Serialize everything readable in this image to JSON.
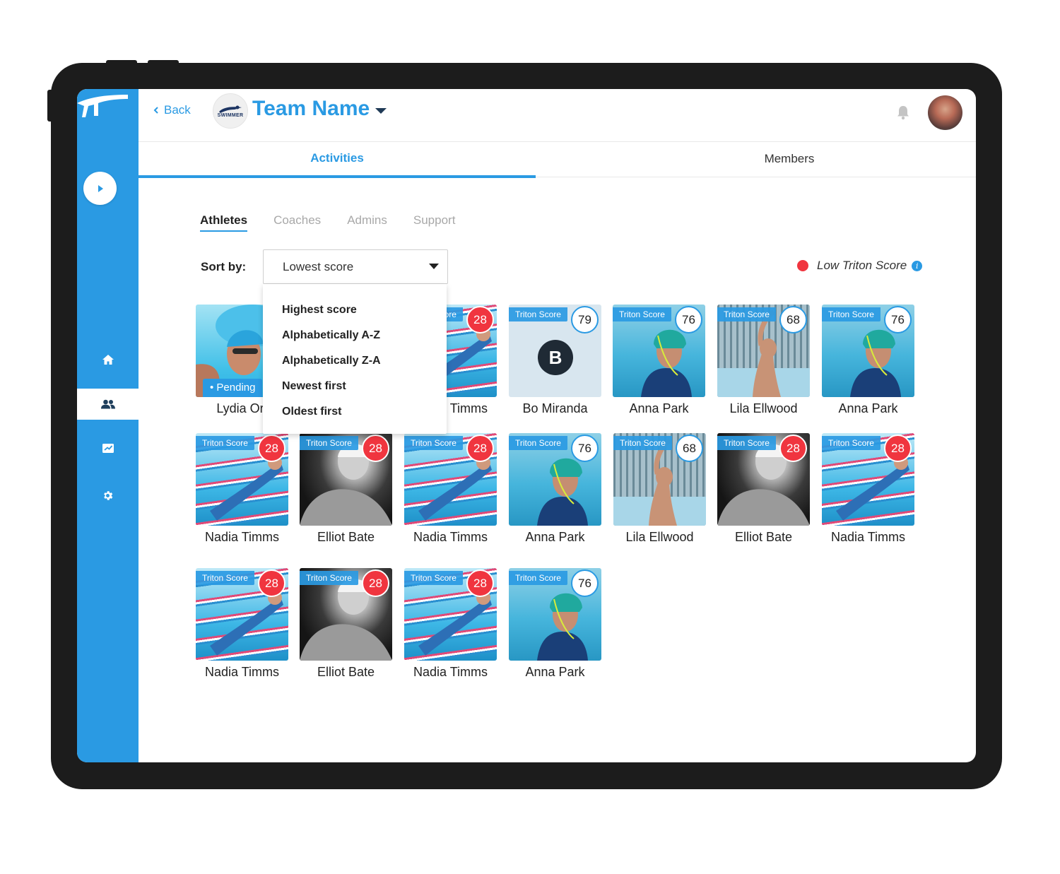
{
  "header": {
    "back_label": "Back",
    "team_logo_text": "SWIMMER",
    "team_name": "Team Name"
  },
  "tabs": [
    {
      "label": "Activities",
      "active": true
    },
    {
      "label": "Members",
      "active": false
    }
  ],
  "subtabs": [
    {
      "label": "Athletes",
      "active": true
    },
    {
      "label": "Coaches",
      "active": false
    },
    {
      "label": "Admins",
      "active": false
    },
    {
      "label": "Support",
      "active": false
    }
  ],
  "sort": {
    "label": "Sort by:",
    "value": "Lowest score",
    "options": [
      "Highest score",
      "Alphabetically A-Z",
      "Alphabetically Z-A",
      "Newest first",
      "Oldest first"
    ]
  },
  "legend": {
    "text": "Low Triton Score",
    "info_glyph": "i",
    "color": "#f0353f"
  },
  "score_label": "Triton Score",
  "pending_label": "• Pending",
  "bo_initial": "B",
  "athletes": [
    {
      "name": "Lydia Ort",
      "score": null,
      "pending": true
    },
    {
      "name": "Nadia Timms",
      "score": "28",
      "low": true
    },
    {
      "name": "Bo Miranda",
      "score": "79",
      "low": false
    },
    {
      "name": "Anna Park",
      "score": "76",
      "low": false
    },
    {
      "name": "Lila Ellwood",
      "score": "68",
      "low": false
    },
    {
      "name": "Anna Park",
      "score": "76",
      "low": false
    },
    {
      "name": "Nadia Timms",
      "score": "28",
      "low": true
    },
    {
      "name": "Elliot Bate",
      "score": "28",
      "low": true
    },
    {
      "name": "Nadia Timms",
      "score": "28",
      "low": true
    },
    {
      "name": "Anna Park",
      "score": "76",
      "low": false
    },
    {
      "name": "Lila Ellwood",
      "score": "68",
      "low": false
    },
    {
      "name": "Elliot Bate",
      "score": "28",
      "low": true
    },
    {
      "name": "Nadia Timms",
      "score": "28",
      "low": true
    },
    {
      "name": "Nadia Timms",
      "score": "28",
      "low": true
    },
    {
      "name": "Elliot Bate",
      "score": "28",
      "low": true
    },
    {
      "name": "Nadia Timms",
      "score": "28",
      "low": true
    },
    {
      "name": "Anna Park",
      "score": "76",
      "low": false
    }
  ],
  "colors": {
    "brand": "#2a9ae3",
    "low_score": "#f0353f"
  },
  "icons": {
    "sidebar": [
      "play-icon",
      "home-icon",
      "people-icon",
      "analytics-icon",
      "gear-icon"
    ],
    "header": [
      "chevron-left-icon",
      "caret-down-icon",
      "bell-icon"
    ]
  }
}
